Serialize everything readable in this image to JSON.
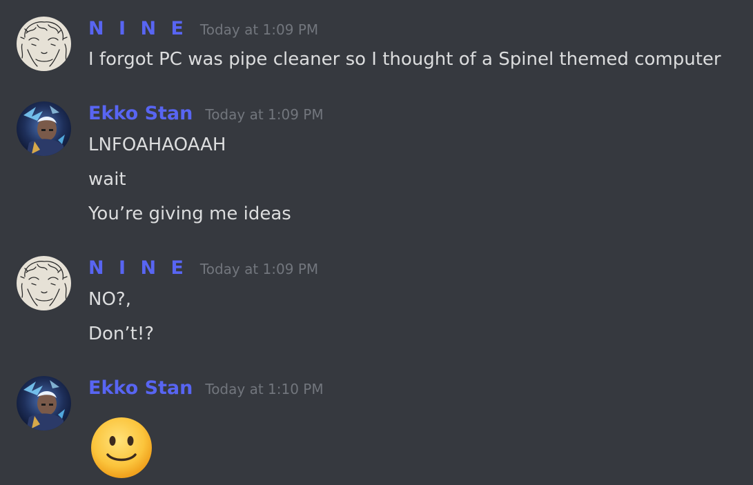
{
  "theme": {
    "background": "#36393f",
    "name_color": "#5865f2",
    "timestamp_color": "#72767d",
    "text_color": "#dcddde"
  },
  "messages": [
    {
      "author": "N I N E",
      "timestamp": "Today at 1:09 PM",
      "avatar_icon": "sketch-anime-avatar",
      "lines": [
        "I forgot PC was pipe cleaner so I thought of a Spinel themed computer"
      ]
    },
    {
      "author": "Ekko Stan",
      "timestamp": "Today at 1:09 PM",
      "avatar_icon": "ekko-avatar",
      "lines": [
        "LNFOAHAOAAH",
        "wait",
        "You’re giving me ideas"
      ]
    },
    {
      "author": "N I N E",
      "timestamp": "Today at 1:09 PM",
      "avatar_icon": "sketch-anime-avatar",
      "lines": [
        "NO?,",
        "Don’t!?"
      ]
    },
    {
      "author": "Ekko Stan",
      "timestamp": "Today at 1:10 PM",
      "avatar_icon": "ekko-avatar",
      "emoji": "slightly-smiling-face-emoji"
    }
  ]
}
